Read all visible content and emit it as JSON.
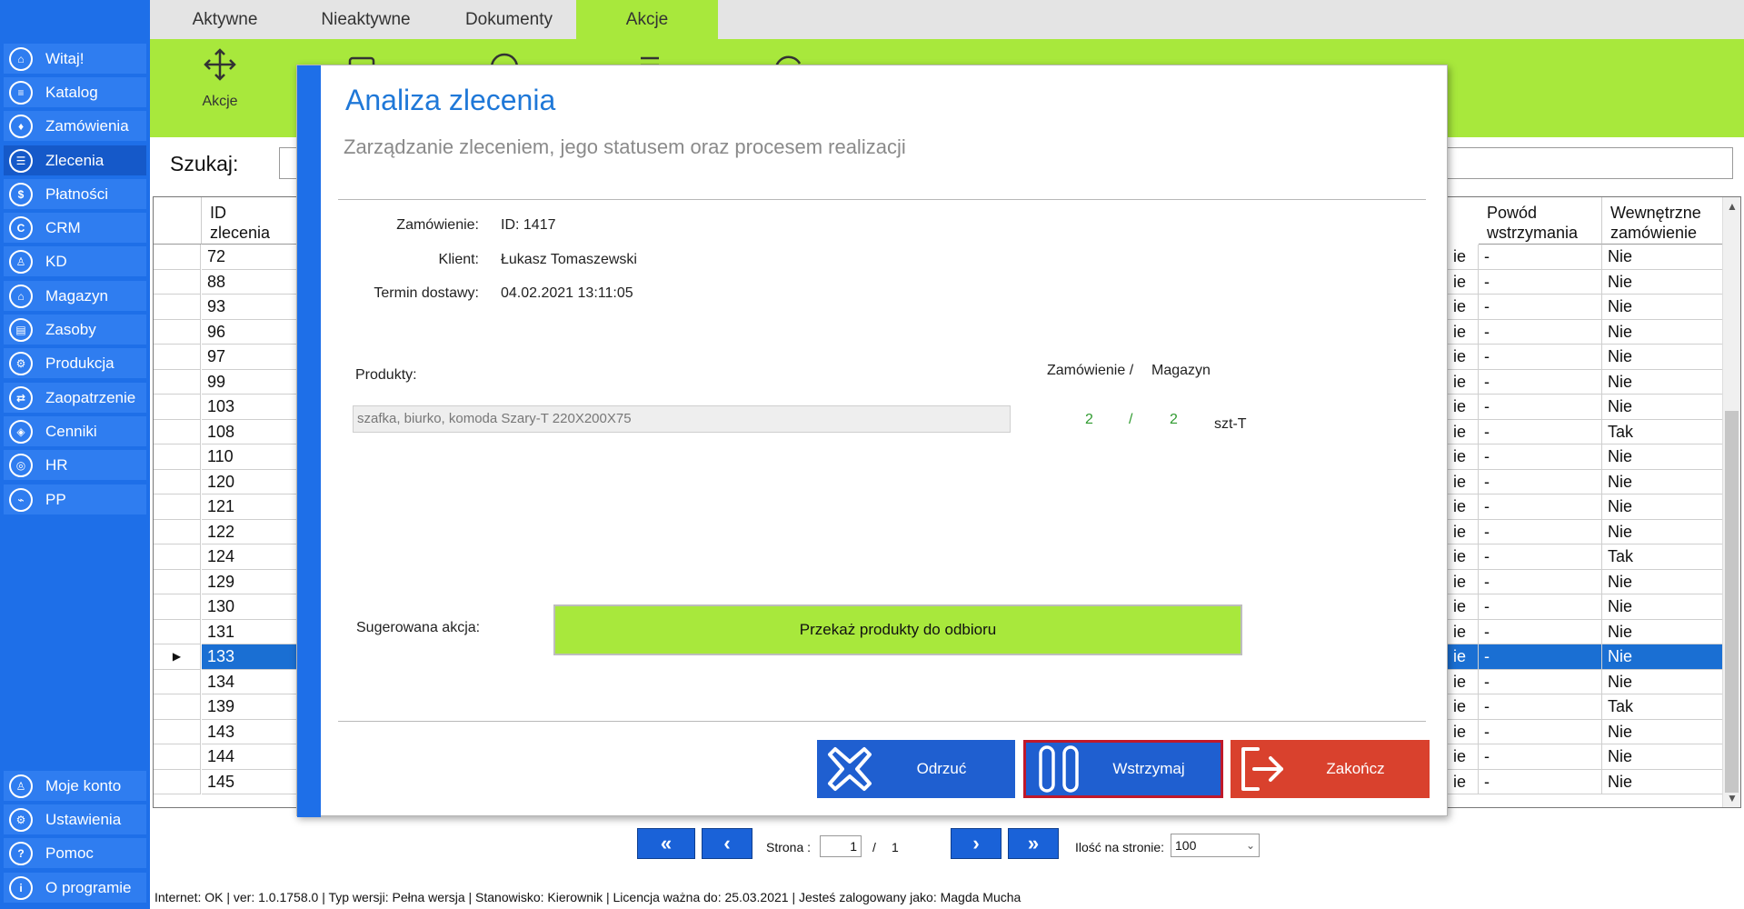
{
  "sidebar": {
    "items": [
      {
        "label": "Witaj!",
        "icon": "home-icon",
        "glyph": "⌂",
        "active": false
      },
      {
        "label": "Katalog",
        "icon": "book-icon",
        "glyph": "≡",
        "active": false
      },
      {
        "label": "Zamówienia",
        "icon": "cart-icon",
        "glyph": "♦",
        "active": false
      },
      {
        "label": "Zlecenia",
        "icon": "list-icon",
        "glyph": "☰",
        "active": true
      },
      {
        "label": "Płatności",
        "icon": "dollar-icon",
        "glyph": "$",
        "active": false
      },
      {
        "label": "CRM",
        "icon": "crm-icon",
        "glyph": "C",
        "active": false
      },
      {
        "label": "KD",
        "icon": "person-icon",
        "glyph": "♙",
        "active": false
      },
      {
        "label": "Magazyn",
        "icon": "warehouse-icon",
        "glyph": "⌂",
        "active": false
      },
      {
        "label": "Zasoby",
        "icon": "box-icon",
        "glyph": "▤",
        "active": false
      },
      {
        "label": "Produkcja",
        "icon": "production-icon",
        "glyph": "⚙",
        "active": false
      },
      {
        "label": "Zaopatrzenie",
        "icon": "supply-icon",
        "glyph": "⇄",
        "active": false
      },
      {
        "label": "Cenniki",
        "icon": "tag-icon",
        "glyph": "◈",
        "active": false
      },
      {
        "label": "HR",
        "icon": "hr-icon",
        "glyph": "◎",
        "active": false
      },
      {
        "label": "PP",
        "icon": "pp-icon",
        "glyph": "⌁",
        "active": false
      }
    ],
    "bottom_items": [
      {
        "label": "Moje konto",
        "icon": "account-icon",
        "glyph": "♙"
      },
      {
        "label": "Ustawienia",
        "icon": "settings-icon",
        "glyph": "⚙"
      },
      {
        "label": "Pomoc",
        "icon": "help-icon",
        "glyph": "?"
      },
      {
        "label": "O programie",
        "icon": "info-icon",
        "glyph": "i"
      }
    ]
  },
  "tabs": [
    "Aktywne",
    "Nieaktywne",
    "Dokumenty",
    "Akcje"
  ],
  "ribbon": {
    "actions_label": "Akcje"
  },
  "search": {
    "label": "Szukaj:",
    "value": ""
  },
  "grid": {
    "headers": {
      "id": "ID\nzlecenia",
      "reason": "Powód\nwstrzymania",
      "internal": "Wewnętrzne\nzamówienie"
    },
    "rows": [
      {
        "id": "72",
        "partial": "ie",
        "reason": "-",
        "internal": "Nie"
      },
      {
        "id": "88",
        "partial": "ie",
        "reason": "-",
        "internal": "Nie"
      },
      {
        "id": "93",
        "partial": "ie",
        "reason": "-",
        "internal": "Nie"
      },
      {
        "id": "96",
        "partial": "ie",
        "reason": "-",
        "internal": "Nie"
      },
      {
        "id": "97",
        "partial": "ie",
        "reason": "-",
        "internal": "Nie"
      },
      {
        "id": "99",
        "partial": "ie",
        "reason": "-",
        "internal": "Nie"
      },
      {
        "id": "103",
        "partial": "ie",
        "reason": "-",
        "internal": "Nie"
      },
      {
        "id": "108",
        "partial": "ie",
        "reason": "-",
        "internal": "Tak"
      },
      {
        "id": "110",
        "partial": "ie",
        "reason": "-",
        "internal": "Nie"
      },
      {
        "id": "120",
        "partial": "ie",
        "reason": "-",
        "internal": "Nie"
      },
      {
        "id": "121",
        "partial": "ie",
        "reason": "-",
        "internal": "Nie"
      },
      {
        "id": "122",
        "partial": "ie",
        "reason": "-",
        "internal": "Nie"
      },
      {
        "id": "124",
        "partial": "ie",
        "reason": "-",
        "internal": "Tak"
      },
      {
        "id": "129",
        "partial": "ie",
        "reason": "-",
        "internal": "Nie"
      },
      {
        "id": "130",
        "partial": "ie",
        "reason": "-",
        "internal": "Nie"
      },
      {
        "id": "131",
        "partial": "ie",
        "reason": "-",
        "internal": "Nie"
      },
      {
        "id": "133",
        "partial": "ie",
        "reason": "-",
        "internal": "Nie",
        "selected": true
      },
      {
        "id": "134",
        "partial": "ie",
        "reason": "-",
        "internal": "Nie"
      },
      {
        "id": "139",
        "partial": "ie",
        "reason": "-",
        "internal": "Tak"
      },
      {
        "id": "143",
        "partial": "ie",
        "reason": "-",
        "internal": "Nie"
      },
      {
        "id": "144",
        "partial": "ie",
        "reason": "-",
        "internal": "Nie"
      },
      {
        "id": "145",
        "partial": "ie",
        "reason": "-",
        "internal": "Nie"
      }
    ]
  },
  "pagination": {
    "page_label": "Strona :",
    "current": "1",
    "separator": "/",
    "total": "1",
    "per_page_label": "Ilość na stronie:",
    "per_page": "100"
  },
  "statusbar": "Internet: OK  |   ver: 1.0.1758.0   |   Typ wersji: Pełna wersja   |   Stanowisko: Kierownik   |   Licencja ważna do: 25.03.2021   |   Jesteś zalogowany jako: Magda Mucha",
  "modal": {
    "title": "Analiza zlecenia",
    "subtitle": "Zarządzanie zleceniem, jego statusem oraz procesem realizacji",
    "order_label": "Zamówienie:",
    "order_value": "ID: 1417",
    "client_label": "Klient:",
    "client_value": "Łukasz Tomaszewski",
    "delivery_label": "Termin dostawy:",
    "delivery_value": "04.02.2021 13:11:05",
    "products_label": "Produkty:",
    "qty_header_order": "Zamówienie /",
    "qty_header_stock": "Magazyn",
    "product_name": "szafka, biurko, komoda Szary-T 220X200X75",
    "qty_order": "2",
    "qty_sep": "/",
    "qty_stock": "2",
    "unit": "szt-T",
    "suggested_label": "Sugerowana akcja:",
    "suggested_action": "Przekaż produkty do odbioru",
    "buttons": {
      "reject": "Odrzuć",
      "hold": "Wstrzymaj",
      "finish": "Zakończ"
    }
  },
  "colors": {
    "sidebar": "#1e6fe8",
    "accent_green": "#a8e83c",
    "reject": "#1f5fd0",
    "hold": "#1f5fd0",
    "hold_border": "#c0192a",
    "finish": "#d9412d",
    "title": "#1f78d8"
  }
}
